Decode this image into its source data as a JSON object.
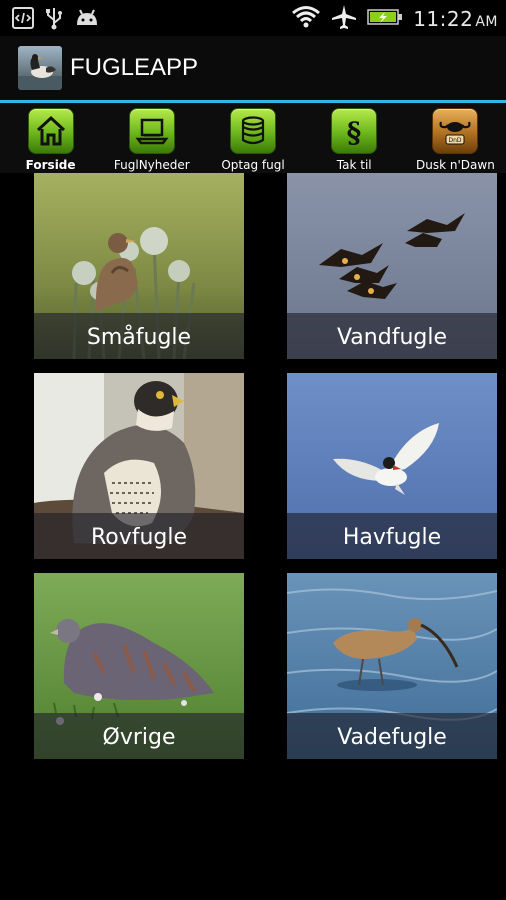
{
  "status_bar": {
    "time": "11:22",
    "ampm": "AM",
    "left_icons": [
      "code-icon",
      "usb-icon",
      "android-icon"
    ],
    "right_icons": [
      "wifi-icon",
      "airplane-icon",
      "battery-charging-icon"
    ]
  },
  "app": {
    "title": "FUGLEAPP",
    "accent": "#33b5e5"
  },
  "tabs": [
    {
      "label": "Forside",
      "icon": "home-icon",
      "active": true
    },
    {
      "label": "FuglNyheder",
      "icon": "laptop-icon",
      "active": false
    },
    {
      "label": "Optag fugl",
      "icon": "database-icon",
      "active": false
    },
    {
      "label": "Tak til",
      "icon": "paragraph-icon",
      "active": false
    },
    {
      "label": "Dusk n'Dawn",
      "icon": "buffalo-icon",
      "active": false
    }
  ],
  "categories": [
    {
      "label": "Småfugle"
    },
    {
      "label": "Vandfugle"
    },
    {
      "label": "Rovfugle"
    },
    {
      "label": "Havfugle"
    },
    {
      "label": "Øvrige"
    },
    {
      "label": "Vadefugle"
    }
  ]
}
